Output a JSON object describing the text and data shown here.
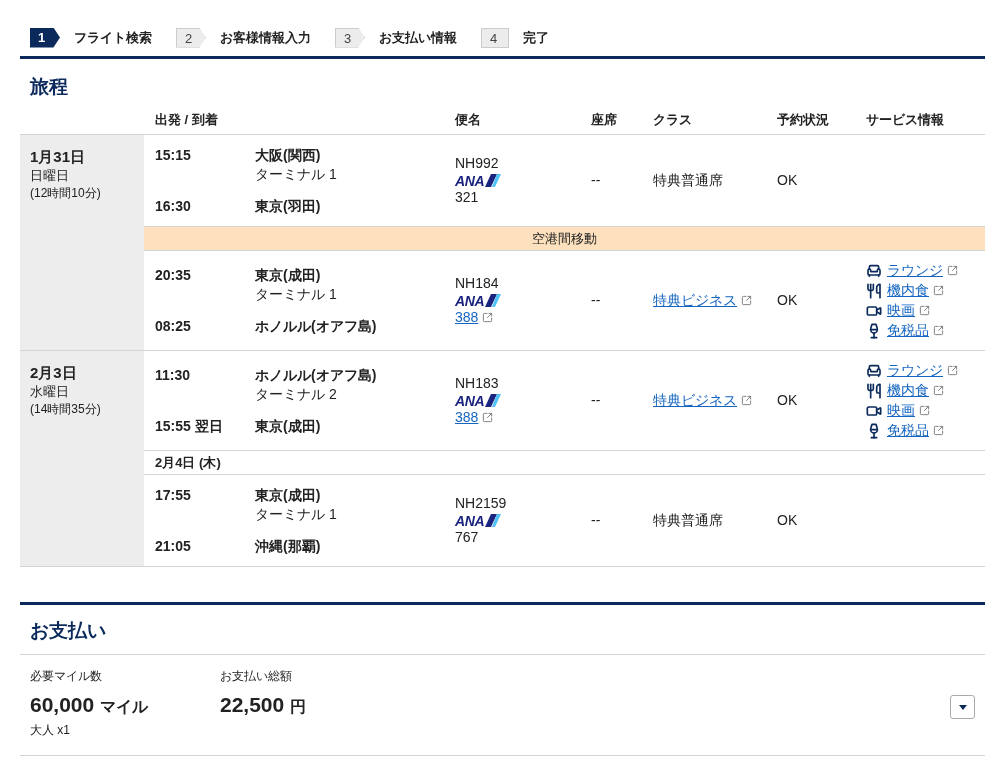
{
  "steps": [
    {
      "number": "1",
      "label": "フライト検索",
      "selected": true
    },
    {
      "number": "2",
      "label": "お客様情報入力",
      "selected": false
    },
    {
      "number": "3",
      "label": "お支払い情報",
      "selected": false
    },
    {
      "number": "4",
      "label": "完了",
      "selected": false
    }
  ],
  "itinerary": {
    "title": "旅程",
    "columns": [
      "出発 / 到着",
      "便名",
      "座席",
      "クラス",
      "予約状況",
      "サービス情報"
    ],
    "days": [
      {
        "date": "1月31日",
        "weekday": "日曜日",
        "duration": "(12時間10分)",
        "segments": [
          {
            "kind": "flight",
            "departure_time": "15:15",
            "departure_airport": "大阪(関西)",
            "terminal": "ターミナル 1",
            "arrival_time": "16:30",
            "arrival_airport": "東京(羽田)",
            "flight_number": "NH992",
            "airline_logo": "ANA",
            "aircraft": "321",
            "aircraft_link": false,
            "seat": "--",
            "class": "特典普通席",
            "class_link": false,
            "status": "OK"
          },
          {
            "kind": "transfer",
            "label": "空港間移動"
          },
          {
            "kind": "flight",
            "departure_time": "20:35",
            "departure_airport": "東京(成田)",
            "terminal": "ターミナル 1",
            "arrival_time": "08:25",
            "arrival_airport": "ホノルル(オアフ島)",
            "flight_number": "NH184",
            "airline_logo": "ANA",
            "aircraft": "388",
            "aircraft_link": true,
            "seat": "--",
            "class": "特典ビジネス",
            "class_link": true,
            "status": "OK",
            "services": [
              {
                "kind": "lounge",
                "label": "ラウンジ"
              },
              {
                "kind": "meal",
                "label": "機内食"
              },
              {
                "kind": "movie",
                "label": "映画"
              },
              {
                "kind": "dutyfree",
                "label": "免税品"
              }
            ]
          }
        ]
      },
      {
        "date": "2月3日",
        "weekday": "水曜日",
        "duration": "(14時間35分)",
        "segments": [
          {
            "kind": "flight",
            "departure_time": "11:30",
            "departure_airport": "ホノルル(オアフ島)",
            "terminal": "ターミナル 2",
            "arrival_time": "15:55",
            "arrival_note": "翌日",
            "arrival_airport": "東京(成田)",
            "flight_number": "NH183",
            "airline_logo": "ANA",
            "aircraft": "388",
            "aircraft_link": true,
            "seat": "--",
            "class": "特典ビジネス",
            "class_link": true,
            "status": "OK",
            "services": [
              {
                "kind": "lounge",
                "label": "ラウンジ"
              },
              {
                "kind": "meal",
                "label": "機内食"
              },
              {
                "kind": "movie",
                "label": "映画"
              },
              {
                "kind": "dutyfree",
                "label": "免税品"
              }
            ]
          },
          {
            "kind": "date",
            "label": "2月4日 (木)"
          },
          {
            "kind": "flight",
            "departure_time": "17:55",
            "departure_airport": "東京(成田)",
            "terminal": "ターミナル 1",
            "arrival_time": "21:05",
            "arrival_airport": "沖縄(那覇)",
            "flight_number": "NH2159",
            "airline_logo": "ANA",
            "aircraft": "767",
            "aircraft_link": false,
            "seat": "--",
            "class": "特典普通席",
            "class_link": false,
            "status": "OK"
          }
        ]
      }
    ]
  },
  "payment": {
    "title": "お支払い",
    "miles": {
      "label": "必要マイル数",
      "value": "60,000",
      "unit": "マイル",
      "note": "大人 x1"
    },
    "total": {
      "label": "お支払い総額",
      "value": "22,500",
      "unit": "円"
    }
  }
}
